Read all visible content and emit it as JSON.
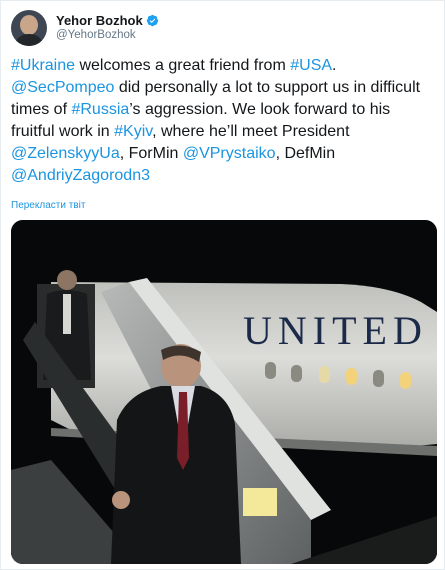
{
  "tweet": {
    "author": {
      "display_name": "Yehor Bozhok",
      "handle": "@YehorBozhok",
      "verified_icon": "verified-badge-icon",
      "avatar_icon": "profile-photo"
    },
    "text_parts": [
      {
        "kind": "hashtag",
        "text": "#Ukraine"
      },
      {
        "kind": "plain",
        "text": " welcomes a great friend from "
      },
      {
        "kind": "hashtag",
        "text": "#USA"
      },
      {
        "kind": "plain",
        "text": ". "
      },
      {
        "kind": "mention",
        "text": "@SecPompeo"
      },
      {
        "kind": "plain",
        "text": " did personally a lot to support us in difficult times of "
      },
      {
        "kind": "hashtag",
        "text": "#Russia"
      },
      {
        "kind": "plain",
        "text": "’s aggression. We look forward to his fruitful work in "
      },
      {
        "kind": "hashtag",
        "text": "#Kyiv"
      },
      {
        "kind": "plain",
        "text": ", where he’ll meet President "
      },
      {
        "kind": "mention",
        "text": "@ZelenskyyUa"
      },
      {
        "kind": "plain",
        "text": ", ForMin "
      },
      {
        "kind": "mention",
        "text": "@VPrystaiko"
      },
      {
        "kind": "plain",
        "text": ", DefMin "
      },
      {
        "kind": "mention",
        "text": "@AndriyZagorodn3"
      }
    ],
    "translate_label": "Перекласти твіт",
    "photo": {
      "aircraft_lettering": "UNITED",
      "colors": {
        "link": "#1b95e0",
        "night_sky": "#070809",
        "fuselage": "#d8d9d5",
        "lettering": "#1c2a4a",
        "window_light": "#f2d27a"
      }
    }
  }
}
